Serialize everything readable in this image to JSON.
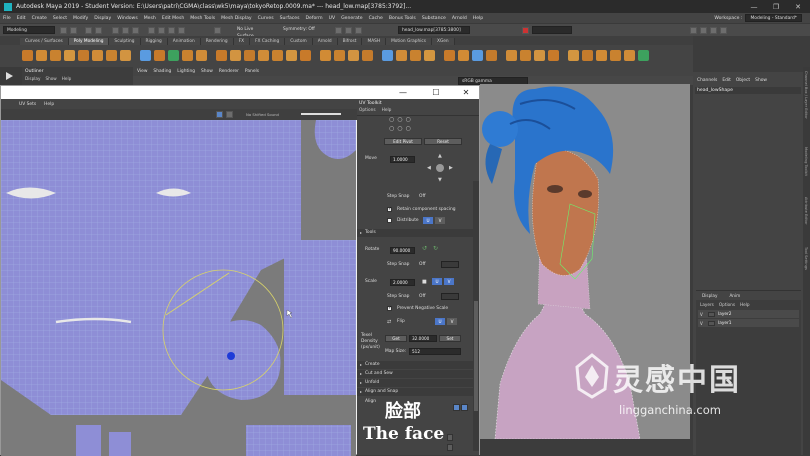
{
  "window": {
    "title": "Autodesk Maya 2019 - Student Version: E:\\Users\\patri\\CGMA\\class\\wk5\\maya\\tokyoRetop.0009.ma*    ---    head_low.map[3785:3792]...",
    "minimize": "—",
    "maximize": "❐",
    "close": "✕"
  },
  "menubar": {
    "items": [
      "File",
      "Edit",
      "Create",
      "Select",
      "Modify",
      "Display",
      "Windows",
      "Mesh",
      "Edit Mesh",
      "Mesh Tools",
      "Mesh Display",
      "Curves",
      "Surfaces",
      "Deform",
      "UV",
      "Generate",
      "Cache",
      "Bonus Tools",
      "Substance",
      "Arnold",
      "Help"
    ],
    "workspace_label": "Workspace :",
    "workspace_value": "Modeling - Standard*"
  },
  "statusline": {
    "mode": "Modeling",
    "live_surface": "No Live Surface",
    "symmetry": "Symmetry: Off",
    "selection_field": "head_low.map[3785:3800]"
  },
  "shelf": {
    "tabs": [
      "Curves / Surfaces",
      "Poly Modeling",
      "Sculpting",
      "Rigging",
      "Animation",
      "Rendering",
      "FX",
      "FX Caching",
      "Custom",
      "Arnold",
      "Bifrost",
      "MASH",
      "Motion Graphics",
      "XGen"
    ],
    "active_tab": "Poly Modeling"
  },
  "outliner": {
    "title": "Outliner",
    "menu": [
      "Display",
      "Show",
      "Help"
    ]
  },
  "viewport": {
    "menu": [
      "View",
      "Shading",
      "Lighting",
      "Show",
      "Renderer",
      "Panels"
    ],
    "color_space": "sRGB gamma"
  },
  "uv_editor": {
    "menu": [
      "UV Sets",
      "Help"
    ],
    "no_tile": "No Shifted Sound",
    "maximize": "☐",
    "minimize": "—",
    "close": "✕"
  },
  "uv_toolkit": {
    "title": "UV Toolkit",
    "menu": [
      "Options",
      "Help"
    ],
    "edit_pivot": "Edit Pivot",
    "reset": "Reset",
    "move_label": "Move",
    "move_value": "1.0000",
    "step_snap_label": "Step Snap",
    "step_snap_value": "Off",
    "retain_spacing": "Retain component spacing",
    "distribute": "Distribute",
    "u": "U",
    "v": "V",
    "tools_section": "Tools",
    "rotate_label": "Rotate",
    "rotate_value": "90.0000",
    "step_snap2": "Step Snap",
    "step_snap2_value": "Off",
    "scale_label": "Scale",
    "scale_value": "2.0000",
    "step_snap3": "Step Snap",
    "step_snap3_value": "Off",
    "prevent_negative": "Prevent Negative Scale",
    "flip": "Flip",
    "texel_label": "Texel Density (px/unit)",
    "get": "Get",
    "texel_value": "32.0000",
    "set": "Set",
    "map_size_label": "Map Size:",
    "map_size_value": "512",
    "sections": [
      "Create",
      "Cut and Sew",
      "Unfold",
      "Align and Snap"
    ],
    "align_label": "Align"
  },
  "channel_box": {
    "menu": [
      "Channels",
      "Edit",
      "Object",
      "Show"
    ],
    "object": "head_lowShape"
  },
  "layers": {
    "tabs": [
      "Display",
      "Anim"
    ],
    "menu": [
      "Layers",
      "Options",
      "Help"
    ],
    "rows": [
      {
        "vis": "V",
        "name": "layer2"
      },
      {
        "vis": "V",
        "name": "layer1"
      }
    ]
  },
  "side_tabs": [
    "Channel Box / Layer Editor",
    "Modeling Toolkit",
    "Attribute Editor",
    "Tool Settings"
  ],
  "subtitles": {
    "cn": "脸部",
    "en": "The face"
  },
  "watermark": {
    "cn": "灵感中国",
    "en": "lingganchina.com"
  }
}
